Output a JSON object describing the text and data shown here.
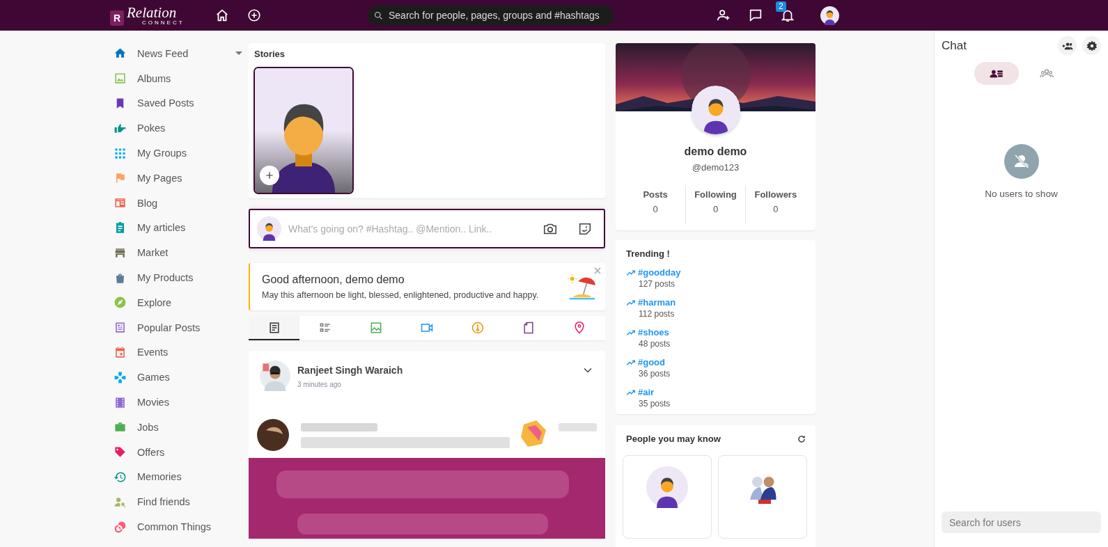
{
  "topbar": {
    "logo_letter": "R",
    "logo_text": "Relation",
    "logo_subtext": "CONNECT",
    "search": {
      "placeholder": "Search for people, pages, groups and #hashtags"
    },
    "notification_count": "2"
  },
  "sidebar": {
    "items": [
      {
        "label": "News Feed",
        "color": "#0277bd",
        "submenu": true
      },
      {
        "label": "Albums",
        "color": "#8bc34a",
        "submenu": false
      },
      {
        "label": "Saved Posts",
        "color": "#673ab7",
        "submenu": false
      },
      {
        "label": "Pokes",
        "color": "#009688",
        "submenu": false
      },
      {
        "label": "My Groups",
        "color": "#03a9f4",
        "submenu": false
      },
      {
        "label": "My Pages",
        "color": "#ffa260",
        "submenu": false
      },
      {
        "label": "Blog",
        "color": "#f25e4e",
        "submenu": false
      },
      {
        "label": "My articles",
        "color": "#009da0",
        "submenu": false
      },
      {
        "label": "Market",
        "color": "#6b6b4d",
        "submenu": false
      },
      {
        "label": "My Products",
        "color": "#5e7a99",
        "submenu": false
      },
      {
        "label": "Explore",
        "color": "#8bc34a",
        "submenu": false
      },
      {
        "label": "Popular Posts",
        "color": "#8c6bd0",
        "submenu": false
      },
      {
        "label": "Events",
        "color": "#f25e4e",
        "submenu": false
      },
      {
        "label": "Games",
        "color": "#03a9f4",
        "submenu": false
      },
      {
        "label": "Movies",
        "color": "#8d6bd3",
        "submenu": false
      },
      {
        "label": "Jobs",
        "color": "#4caf50",
        "submenu": false
      },
      {
        "label": "Offers",
        "color": "#e91e63",
        "submenu": false
      },
      {
        "label": "Memories",
        "color": "#009688",
        "submenu": false
      },
      {
        "label": "Find friends",
        "color": "#a5b56b",
        "submenu": false
      },
      {
        "label": "Common Things",
        "color": "#ff5a7a",
        "submenu": false
      }
    ]
  },
  "stories": {
    "title": "Stories"
  },
  "composer": {
    "placeholder": "What's going on? #Hashtag.. @Mention.. Link.."
  },
  "greeting": {
    "title": "Good afternoon, demo demo",
    "message": "May this afternoon be light, blessed, enlightened, productive and happy."
  },
  "post_types": [
    {
      "selected": true,
      "color": "#333333"
    },
    {
      "selected": false,
      "color": "#777777"
    },
    {
      "selected": false,
      "color": "#4caf50"
    },
    {
      "selected": false,
      "color": "#2196f3"
    },
    {
      "selected": false,
      "color": "#e8950b"
    },
    {
      "selected": false,
      "color": "#7b3f8c"
    },
    {
      "selected": false,
      "color": "#e91e63"
    }
  ],
  "post": {
    "author": "Ranjeet Singh Waraich",
    "time": "3 minutes ago"
  },
  "profile": {
    "name": "demo demo",
    "handle": "@demo123",
    "stats": [
      {
        "label": "Posts",
        "value": "0"
      },
      {
        "label": "Following",
        "value": "0"
      },
      {
        "label": "Followers",
        "value": "0"
      }
    ]
  },
  "trending": {
    "title": "Trending !",
    "tags": [
      {
        "tag": "#goodday",
        "count": "127 posts"
      },
      {
        "tag": "#harman",
        "count": "112 posts"
      },
      {
        "tag": "#shoes",
        "count": "48 posts"
      },
      {
        "tag": "#good",
        "count": "36 posts"
      },
      {
        "tag": "#air",
        "count": "35 posts"
      }
    ]
  },
  "people": {
    "title": "People you may know",
    "cards": [
      {
        "kind": "avatar"
      },
      {
        "kind": "picture"
      }
    ]
  },
  "chat": {
    "title": "Chat",
    "tabs": [
      {
        "selected": true
      },
      {
        "selected": false
      }
    ],
    "empty_message": "No users to show",
    "search": {
      "placeholder": "Search for users"
    }
  }
}
